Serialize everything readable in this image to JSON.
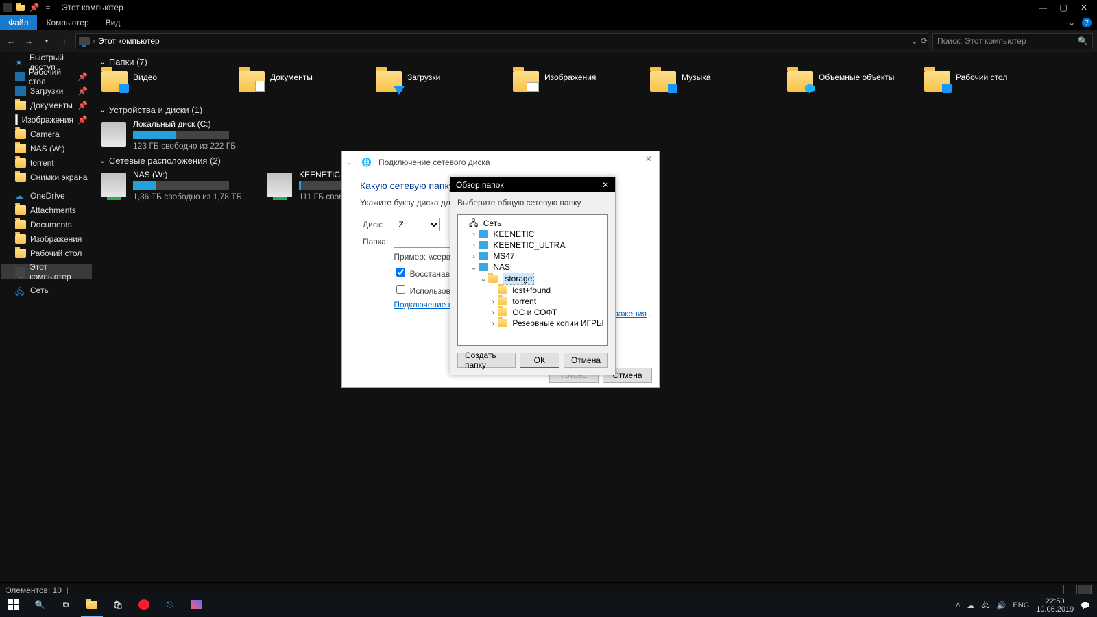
{
  "window": {
    "title": "Этот компьютер"
  },
  "ribbon": {
    "file": "Файл",
    "computer": "Компьютер",
    "view": "Вид"
  },
  "addressbar": {
    "location": "Этот компьютер"
  },
  "search": {
    "placeholder": "Поиск: Этот компьютер"
  },
  "sidebar": {
    "quickaccess": "Быстрый доступ",
    "items1": [
      "Рабочий стол",
      "Загрузки",
      "Документы",
      "Изображения",
      "Camera",
      "NAS (W:)",
      "torrent",
      "Снимки экрана"
    ],
    "onedrive": "OneDrive",
    "items2": [
      "Attachments",
      "Documents",
      "Изображения",
      "Рабочий стол"
    ],
    "thispc": "Этот компьютер",
    "network": "Сеть"
  },
  "sections": {
    "folders": "Папки (7)",
    "devices": "Устройства и диски (1)",
    "network": "Сетевые расположения (2)"
  },
  "folders": [
    "Видео",
    "Документы",
    "Загрузки",
    "Изображения",
    "Музыка",
    "Объемные объекты",
    "Рабочий стол"
  ],
  "cdrive": {
    "name": "Локальный диск (C:)",
    "free": "123 ГБ свободно из 222 ГБ",
    "pct": 45
  },
  "netdrives": [
    {
      "name": "NAS (W:)",
      "free": "1,36 ТБ свободно из 1,78 ТБ",
      "pct": 24
    },
    {
      "name": "KEENETIC (X:)",
      "free": "111 ГБ свободно из 111 ГБ",
      "pct": 2
    }
  ],
  "status": {
    "count": "Элементов: 10"
  },
  "wizard": {
    "title": "Подключение сетевого диска",
    "question": "Какую сетевую папку вы",
    "help": "Укажите букву диска для подкл",
    "lbl_drive": "Диск:",
    "drive_val": "Z:",
    "lbl_folder": "Папка:",
    "example": "Пример: \\\\сервер",
    "cb1": "Восстанавливат",
    "cb2": "Использовать д",
    "link1": "Подключение к в",
    "link2": "бражения",
    "btn_done": "Готово",
    "btn_cancel": "Отмена"
  },
  "browse": {
    "title": "Обзор папок",
    "subtitle": "Выберите общую сетевую папку",
    "tree": {
      "root": "Сеть",
      "keenetic": "KEENETIC",
      "keenetic_u": "KEENETIC_ULTRA",
      "ms47": "MS47",
      "nas": "NAS",
      "storage": "storage",
      "lostfound": "lost+found",
      "torrent": "torrent",
      "os": "ОС и СОФТ",
      "backup": "Резервные копии ИГРЫ"
    },
    "btn_newfolder": "Создать папку",
    "btn_ok": "ОК",
    "btn_cancel": "Отмена"
  },
  "tray": {
    "lang": "ENG",
    "time": "22:50",
    "date": "10.06.2019"
  }
}
